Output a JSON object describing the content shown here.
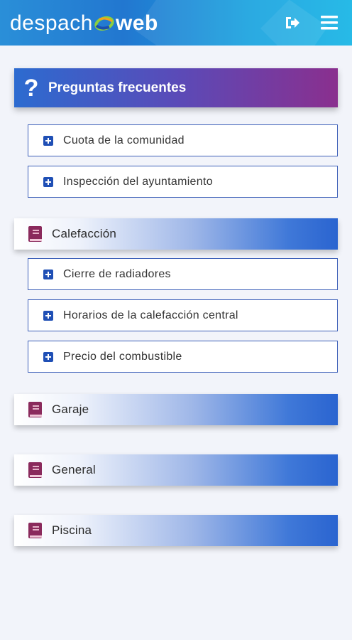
{
  "header": {
    "logo_left": "despach",
    "logo_right": "web",
    "logout_icon": "logout-icon",
    "menu_icon": "hamburger-menu-icon",
    "colors": {
      "bar": "#2277d0",
      "logo_ring_green": "#8ccf3f",
      "logo_ring_blue": "#1c4fae"
    }
  },
  "faq": {
    "icon": "question-mark-icon",
    "title": "Preguntas frecuentes",
    "general_items": [
      {
        "label": "Cuota de la comunidad"
      },
      {
        "label": "Inspección del ayuntamiento"
      }
    ]
  },
  "categories": [
    {
      "label": "Calefacción",
      "icon": "book-icon",
      "expanded": true,
      "items": [
        {
          "label": "Cierre de radiadores"
        },
        {
          "label": "Horarios de la calefacción central"
        },
        {
          "label": "Precio del combustible"
        }
      ]
    },
    {
      "label": "Garaje",
      "icon": "book-icon",
      "expanded": false
    },
    {
      "label": "General",
      "icon": "book-icon",
      "expanded": false
    },
    {
      "label": "Piscina",
      "icon": "book-icon",
      "expanded": false
    }
  ],
  "colors": {
    "accent_blue": "#1f4fb5",
    "faq_gradient_start": "#2c6bd0",
    "faq_gradient_end": "#8a2f8e",
    "book": "#8a2a5c"
  }
}
